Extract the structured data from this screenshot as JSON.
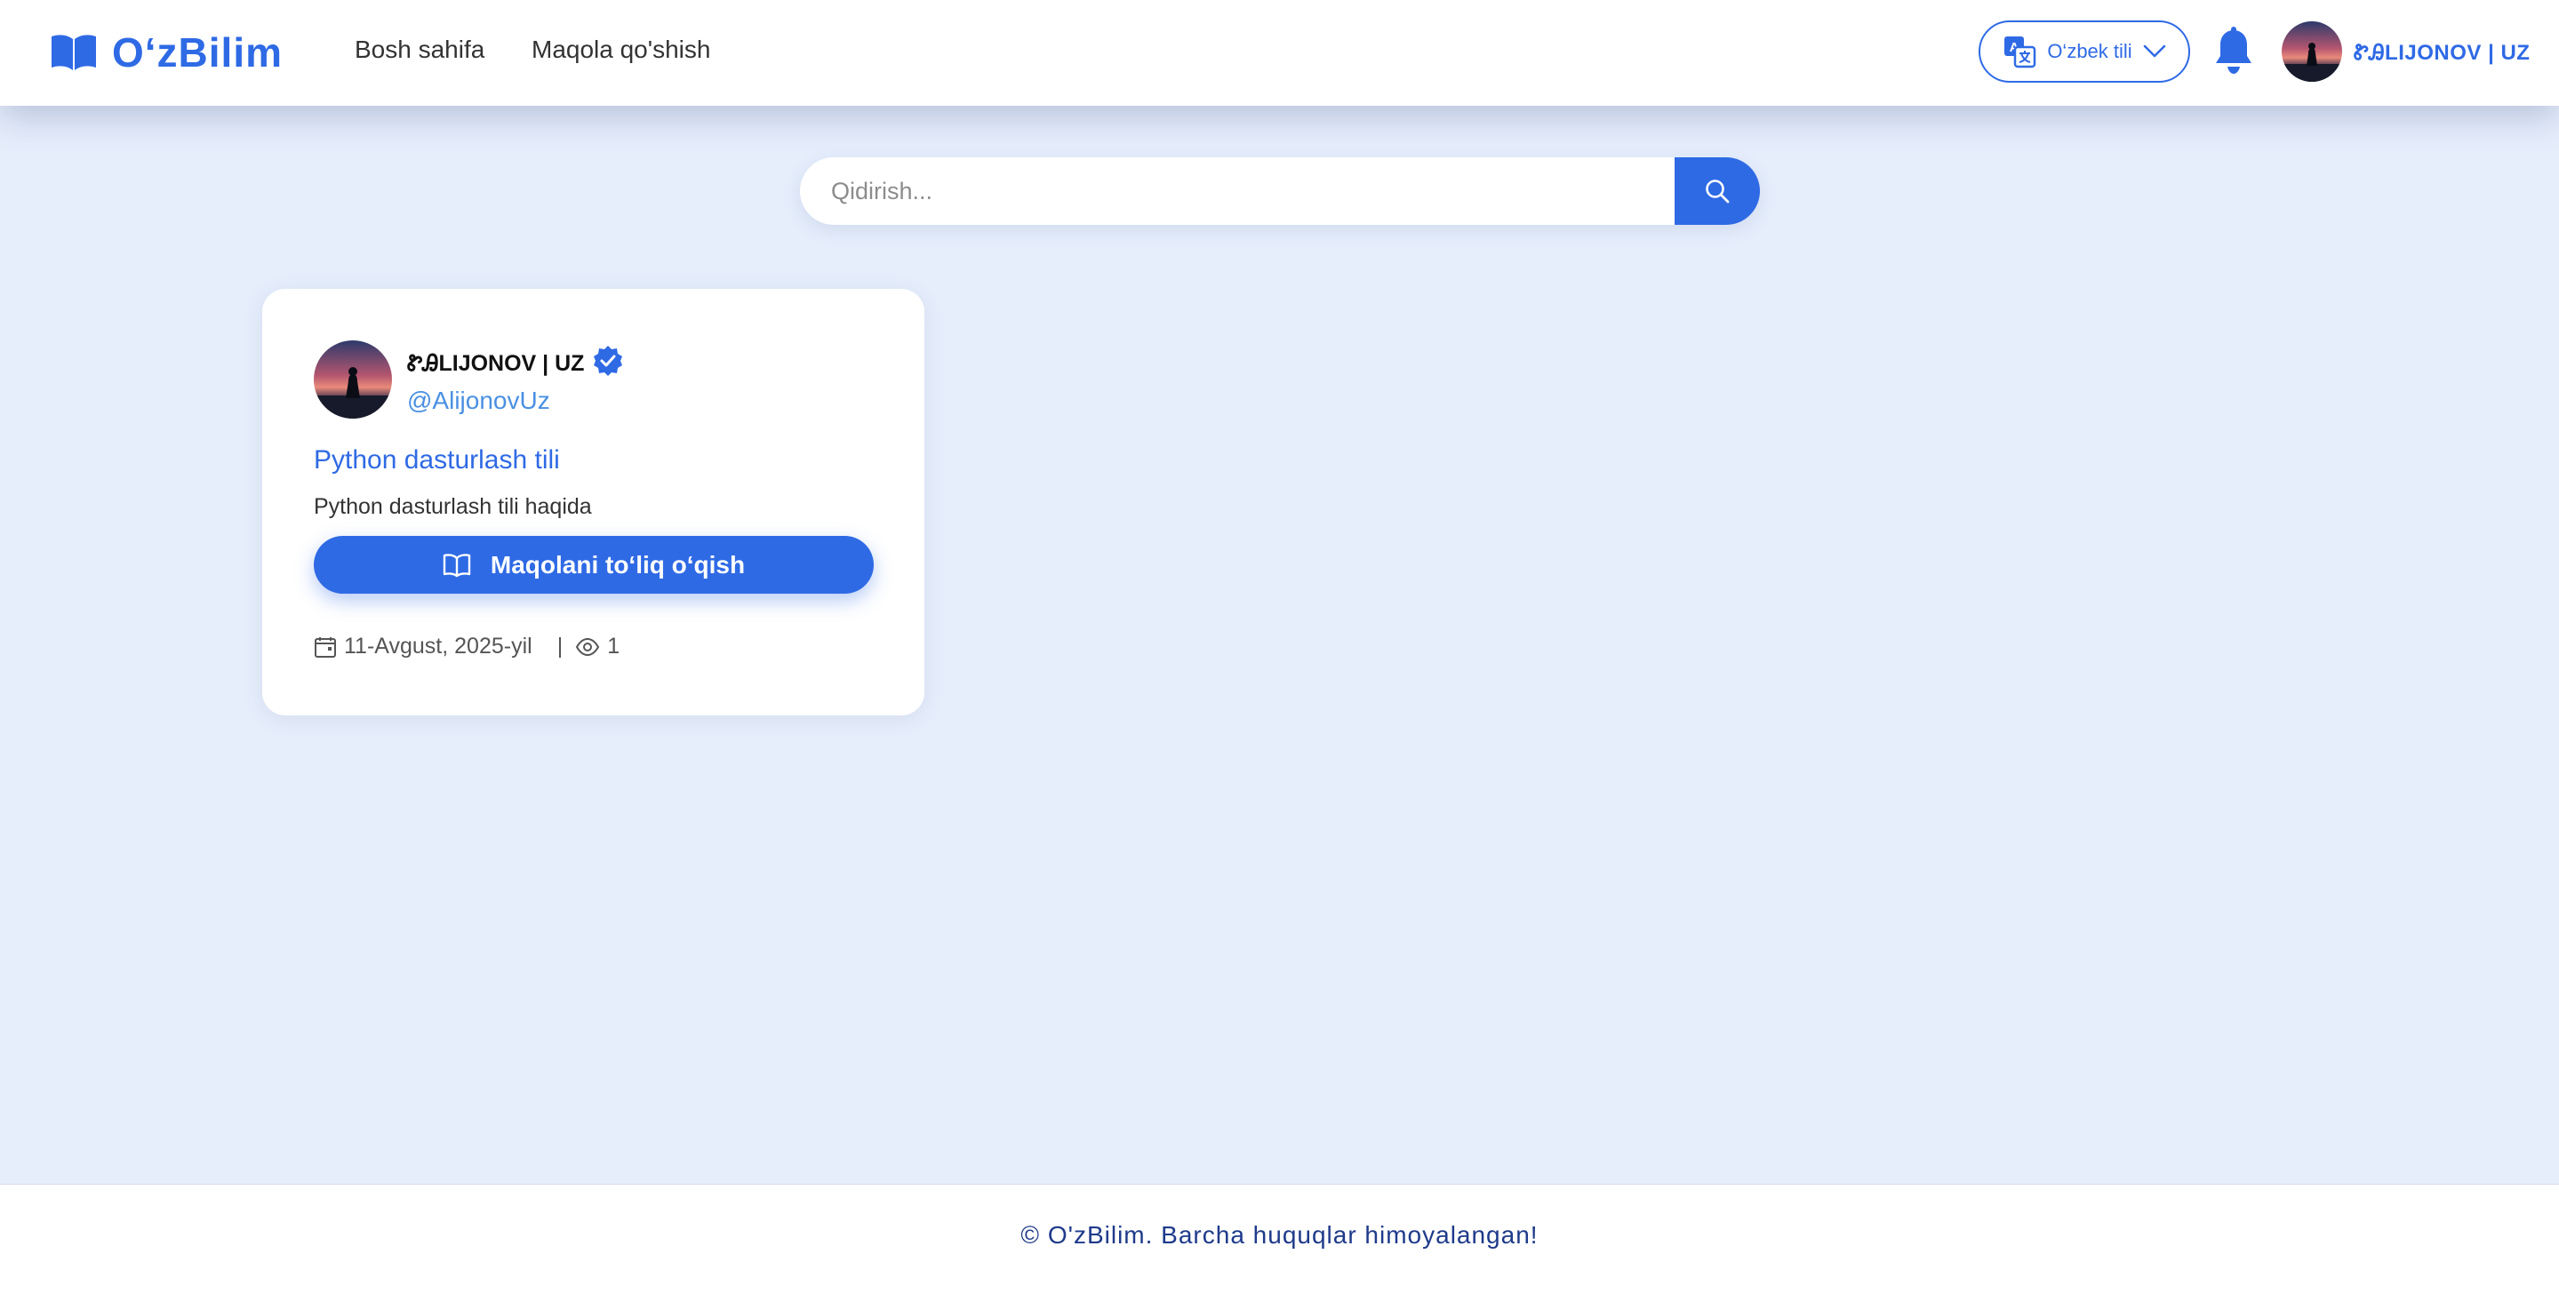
{
  "header": {
    "brand": "O‘zBilim",
    "nav": {
      "home": "Bosh sahifa",
      "add_article": "Maqola qo'shish"
    },
    "language": {
      "selected": "O‘zbek tili"
    },
    "user": {
      "name": "ᏑᎯLIJONOV | UZ"
    }
  },
  "search": {
    "placeholder": "Qidirish..."
  },
  "articles": [
    {
      "author_name": "ᏑᎯLIJONOV | UZ",
      "author_handle": "@AlijonovUz",
      "title": "Python dasturlash tili",
      "description": "Python dasturlash tili haqida",
      "read_button": "Maqolani to‘liq o‘qish",
      "date": "11-Avgust, 2025-yil",
      "separator": "|",
      "views": "1"
    }
  ],
  "footer": {
    "text": "© O'zBilim. Barcha huquqlar himoyalangan!"
  },
  "colors": {
    "accent": "#2f6ae5",
    "background": "#e6eefc",
    "footer_text": "#1e3a8a",
    "handle": "#4a90e2"
  },
  "icons": {
    "brand": "open-book-icon",
    "language": "translate-icon",
    "notification": "bell-icon",
    "search": "search-icon",
    "verified": "verified-badge-icon",
    "read": "open-book-icon",
    "date": "calendar-icon",
    "views": "eye-icon"
  }
}
